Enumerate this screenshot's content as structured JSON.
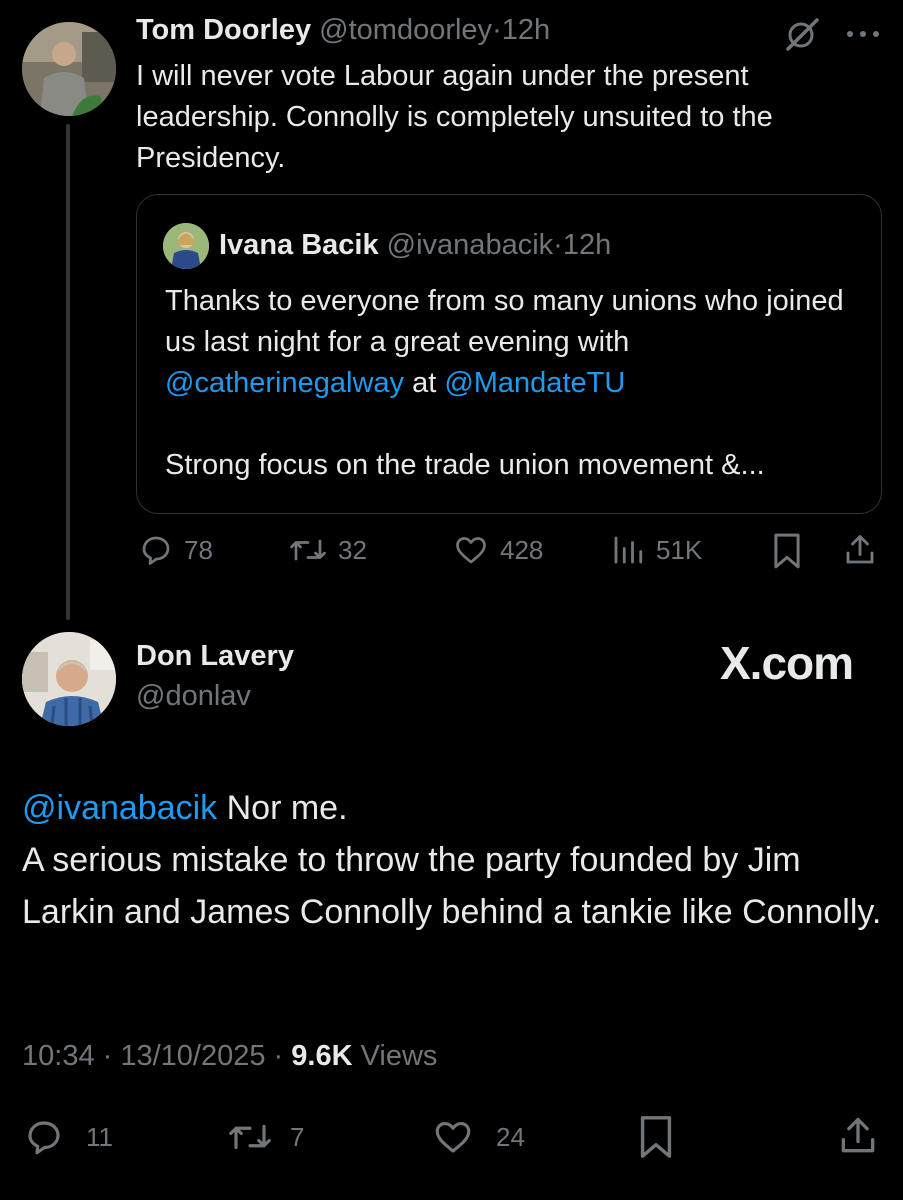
{
  "tweet1": {
    "author_name": "Tom Doorley",
    "author_handle": "@tomdoorley",
    "sep": "·",
    "time": "12h",
    "text": "I will never vote Labour again under the present leadership. Connolly is completely unsuited to the Presidency.",
    "quote": {
      "author_name": "Ivana Bacik",
      "author_handle": "@ivanabacik",
      "time": "12h",
      "line1_prefix": "Thanks to everyone from so many unions who joined us last night for a great evening with",
      "mention1": "@catherinegalway",
      "mid": "at",
      "mention2": "@MandateTU",
      "line2": "Strong focus on the trade union movement &..."
    },
    "actions": {
      "replies": "78",
      "reposts": "32",
      "likes": "428",
      "views": "51K"
    }
  },
  "tweet2": {
    "author_name": "Don Lavery",
    "author_handle": "@donlav",
    "watermark": "X.com",
    "mention": "@ivanabacik",
    "line1_rest": "Nor me.",
    "line2": "A serious mistake to throw the party founded by Jim Larkin and James Connolly behind a tankie like Connolly.",
    "timestamp": "10:34 · 13/10/2025 ·",
    "views_count": "9.6K",
    "views_label": "Views",
    "actions": {
      "replies": "11",
      "reposts": "7",
      "likes": "24"
    }
  },
  "colors": {
    "background": "#000000",
    "text": "#e7e9ea",
    "muted": "#71767b",
    "link": "#1d9bf0",
    "border": "#2f3336"
  }
}
